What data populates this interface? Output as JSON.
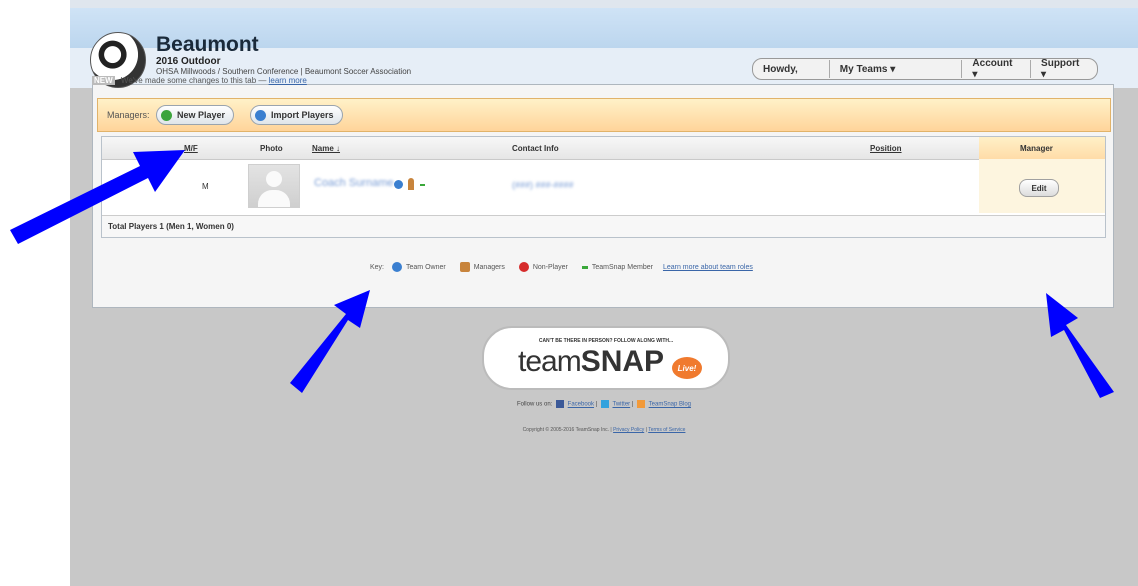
{
  "team": {
    "name": "Beaumont",
    "season": "2016 Outdoor",
    "league": "OHSA Millwoods / Southern Conference | Beaumont Soccer Association"
  },
  "notice": {
    "badge": "NEW",
    "text": "We've made some changes to this tab —",
    "link": "learn more"
  },
  "nav": {
    "howdy": "Howdy,",
    "my_teams": "My Teams ▾",
    "account": "Account ▾",
    "support": "Support ▾"
  },
  "managers": {
    "label": "Managers:",
    "new_player": "New Player",
    "import_players": "Import Players"
  },
  "table": {
    "headers": {
      "mf": "M/F",
      "photo": "Photo",
      "name": "Name ↓",
      "contact": "Contact Info",
      "position": "Position",
      "manager": "Manager"
    },
    "rows": [
      {
        "mf": "M",
        "name": "Coach Surname",
        "contact": "(###) ###-####",
        "edit": "Edit"
      }
    ],
    "totals": "Total Players 1 (Men 1, Women 0)"
  },
  "key": {
    "label": "Key:",
    "team_owner": "Team Owner",
    "managers": "Managers",
    "non_player": "Non-Player",
    "teamsnap_member": "TeamSnap Member",
    "learn_more": "Learn more about team roles"
  },
  "footer": {
    "badge_tagline": "CAN'T BE THERE IN PERSON? FOLLOW ALONG WITH...",
    "logo_team": "team",
    "logo_snap": "SNAP",
    "logo_live": "Live!",
    "follow_label": "Follow us on:",
    "facebook": "Facebook",
    "twitter": "Twitter",
    "blog": "TeamSnap Blog",
    "copyright": "Copyright © 2005-2016 TeamSnap Inc.",
    "privacy": "Privacy Policy",
    "terms": "Terms of Service"
  },
  "colors": {
    "arrow": "#0000ff",
    "manager_bar": "#ffd49a",
    "link": "#3a66a8",
    "live": "#f07a2e"
  }
}
